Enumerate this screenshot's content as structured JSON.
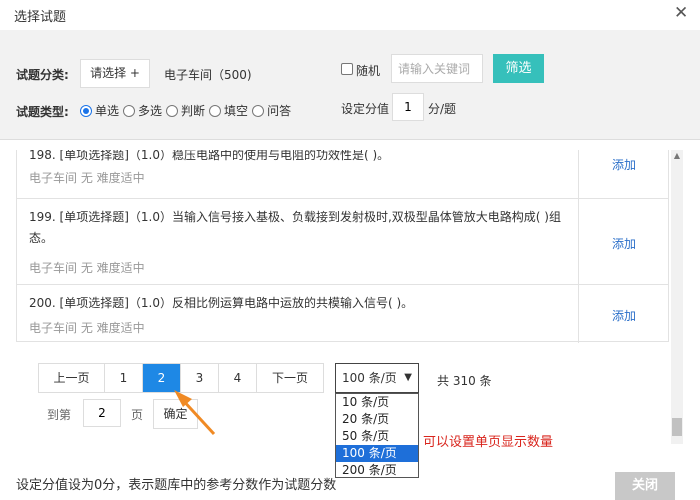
{
  "dialog": {
    "title": "选择试题",
    "close_glyph": "✕"
  },
  "filter": {
    "category_label": "试题分类:",
    "select_button": "请选择 +",
    "category_value": "电子车间（500)",
    "type_label": "试题类型:",
    "types": [
      {
        "label": "单选",
        "checked": true
      },
      {
        "label": "多选",
        "checked": false
      },
      {
        "label": "判断",
        "checked": false
      },
      {
        "label": "填空",
        "checked": false
      },
      {
        "label": "问答",
        "checked": false
      }
    ],
    "random_label": "随机",
    "keyword_placeholder": "请输入关键词",
    "filter_button": "筛选",
    "score_label": "设定分值",
    "score_value": "1",
    "score_unit": "分/题"
  },
  "questions": [
    {
      "text": "198. [单项选择题]（1.0）稳压电路中的使用与电阻的功效性是( )。",
      "meta": "电子车间  无  难度适中",
      "add": "添加"
    },
    {
      "text": "199. [单项选择题]（1.0）当输入信号接入基极、负载接到发射极时,双极型晶体管放大电路构成( )组态。",
      "meta": "电子车间  无  难度适中",
      "add": "添加"
    },
    {
      "text": "200. [单项选择题]（1.0）反相比例运算电路中运放的共模输入信号( )。",
      "meta": "电子车间  无  难度适中",
      "add": "添加"
    }
  ],
  "pagination": {
    "prev": "上一页",
    "pages": [
      "1",
      "2",
      "3",
      "4"
    ],
    "current_page": "2",
    "next": "下一页",
    "page_size": "100 条/页",
    "total": "共 310 条",
    "jump_label": "到第",
    "jump_value": "2",
    "jump_unit": "页",
    "go_button": "确定",
    "size_options": [
      "10 条/页",
      "20 条/页",
      "50 条/页",
      "100 条/页",
      "200 条/页"
    ],
    "selected_size": "100 条/页"
  },
  "annotation": {
    "hint": "可以设置单页显示数量",
    "arrow_color": "#f08a24",
    "hint_color": "#d9251d"
  },
  "footer": {
    "note": "设定分值设为0分，表示题库中的参考分数作为试题分数",
    "close_button": "关闭"
  },
  "colors": {
    "accent": "#36c0bb",
    "active_page": "#1e88e5",
    "link": "#2b6fc9"
  }
}
